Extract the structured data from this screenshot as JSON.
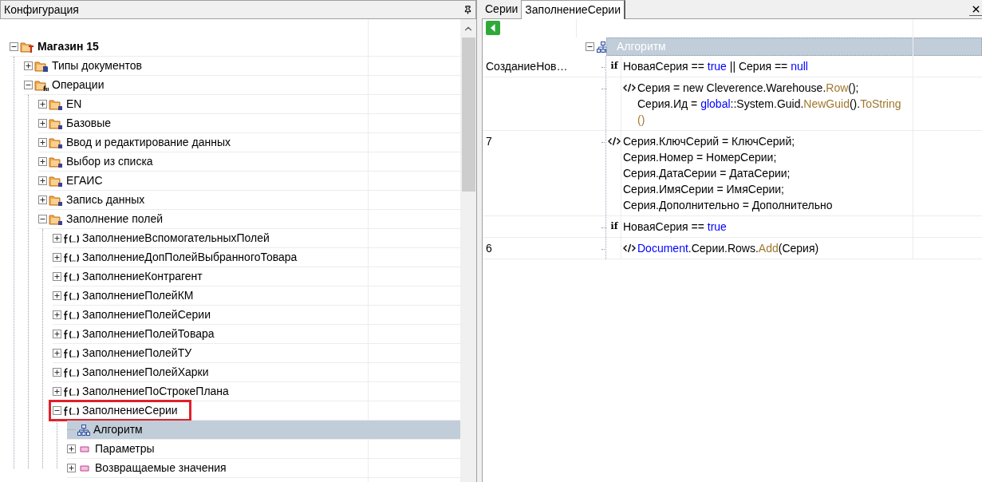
{
  "left_panel": {
    "title": "Конфигурация",
    "tree": [
      {
        "label": "Магазин 15",
        "kind": "root",
        "expanded": true,
        "selected": false,
        "highlighted": false,
        "children": [
          {
            "label": "Типы документов",
            "kind": "doc-folder",
            "expanded": false,
            "selected": false,
            "highlighted": false
          },
          {
            "label": "Операции",
            "kind": "func-folder",
            "expanded": true,
            "selected": false,
            "highlighted": false,
            "children": [
              {
                "label": "EN",
                "kind": "folder",
                "expanded": false,
                "selected": false,
                "highlighted": false
              },
              {
                "label": "Базовые",
                "kind": "folder",
                "expanded": false,
                "selected": false,
                "highlighted": false
              },
              {
                "label": "Ввод и редактирование данных",
                "kind": "folder",
                "expanded": false,
                "selected": false,
                "highlighted": false
              },
              {
                "label": "Выбор из списка",
                "kind": "folder",
                "expanded": false,
                "selected": false,
                "highlighted": false
              },
              {
                "label": "ЕГАИС",
                "kind": "folder",
                "expanded": false,
                "selected": false,
                "highlighted": false
              },
              {
                "label": "Запись данных",
                "kind": "folder",
                "expanded": false,
                "selected": false,
                "highlighted": false
              },
              {
                "label": "Заполнение полей",
                "kind": "folder",
                "expanded": true,
                "selected": false,
                "highlighted": false,
                "children": [
                  {
                    "label": "ЗаполнениеВспомогательныхПолей",
                    "kind": "function",
                    "expanded": false,
                    "selected": false,
                    "highlighted": false
                  },
                  {
                    "label": "ЗаполнениеДопПолейВыбранногоТовара",
                    "kind": "function",
                    "expanded": false,
                    "selected": false,
                    "highlighted": false
                  },
                  {
                    "label": "ЗаполнениеКонтрагент",
                    "kind": "function",
                    "expanded": false,
                    "selected": false,
                    "highlighted": false
                  },
                  {
                    "label": "ЗаполнениеПолейКМ",
                    "kind": "function",
                    "expanded": false,
                    "selected": false,
                    "highlighted": false
                  },
                  {
                    "label": "ЗаполнениеПолейСерии",
                    "kind": "function",
                    "expanded": false,
                    "selected": false,
                    "highlighted": false
                  },
                  {
                    "label": "ЗаполнениеПолейТовара",
                    "kind": "function",
                    "expanded": false,
                    "selected": false,
                    "highlighted": false
                  },
                  {
                    "label": "ЗаполнениеПолейТУ",
                    "kind": "function",
                    "expanded": false,
                    "selected": false,
                    "highlighted": false
                  },
                  {
                    "label": "ЗаполнениеПолейХарки",
                    "kind": "function",
                    "expanded": false,
                    "selected": false,
                    "highlighted": false
                  },
                  {
                    "label": "ЗаполнениеПоСтрокеПлана",
                    "kind": "function",
                    "expanded": false,
                    "selected": false,
                    "highlighted": false
                  },
                  {
                    "label": "ЗаполнениеСерии",
                    "kind": "function",
                    "expanded": true,
                    "selected": false,
                    "highlighted": true,
                    "children": [
                      {
                        "label": "Алгоритм",
                        "kind": "algorithm",
                        "selected": true,
                        "highlighted": false
                      },
                      {
                        "label": "Параметры",
                        "kind": "param",
                        "expanded": false,
                        "selected": false,
                        "highlighted": false
                      },
                      {
                        "label": "Возвращаемые значения",
                        "kind": "param",
                        "expanded": false,
                        "selected": false,
                        "highlighted": false
                      }
                    ]
                  }
                ]
              }
            ]
          }
        ]
      }
    ]
  },
  "right_panel": {
    "tabs": [
      {
        "label": "Серии",
        "selected": false
      },
      {
        "label": "ЗаполнениеСерии",
        "selected": true
      }
    ],
    "algorithm": {
      "label": "Алгоритм",
      "expanded": true,
      "selected": true,
      "children": [
        {
          "kind": "if",
          "badge": "if",
          "column_1": "СозданиеНов…",
          "lines": [
            [
              {
                "text": "НоваяСерия == ",
                "kind": "plain"
              },
              {
                "text": "true",
                "kind": "keyword"
              },
              {
                "text": " || Серия == ",
                "kind": "plain"
              },
              {
                "text": "null",
                "kind": "keyword"
              }
            ]
          ],
          "children": [
            {
              "kind": "code",
              "lines": [
                [
                  {
                    "text": "Серия = new Cleverence.Warehouse.",
                    "kind": "plain"
                  },
                  {
                    "text": "Row",
                    "kind": "member"
                  },
                  {
                    "text": "();",
                    "kind": "plain"
                  }
                ],
                [
                  {
                    "text": "Серия.Ид = ",
                    "kind": "plain"
                  },
                  {
                    "text": "global",
                    "kind": "keyword"
                  },
                  {
                    "text": "::System.Guid.",
                    "kind": "plain"
                  },
                  {
                    "text": "NewGuid",
                    "kind": "member"
                  },
                  {
                    "text": "().",
                    "kind": "plain"
                  },
                  {
                    "text": "ToString",
                    "kind": "member"
                  }
                ],
                [
                  {
                    "text": "()",
                    "kind": "member"
                  }
                ]
              ]
            }
          ]
        },
        {
          "kind": "code",
          "column_1": "7",
          "lines": [
            [
              {
                "text": "Серия.КлючСерий = КлючСерий;",
                "kind": "plain"
              }
            ],
            [
              {
                "text": "Серия.Номер = НомерСерии;",
                "kind": "plain"
              }
            ],
            [
              {
                "text": "Серия.ДатаСерии = ДатаСерии;",
                "kind": "plain"
              }
            ],
            [
              {
                "text": "Серия.ИмяСерии = ИмяСерии;",
                "kind": "plain"
              }
            ],
            [
              {
                "text": "Серия.Дополнительно = Дополнительно",
                "kind": "plain"
              }
            ]
          ]
        },
        {
          "kind": "if",
          "badge": "if",
          "lines": [
            [
              {
                "text": "НоваяСерия == ",
                "kind": "plain"
              },
              {
                "text": "true",
                "kind": "keyword"
              }
            ]
          ],
          "children": [
            {
              "kind": "code",
              "column_1": "6",
              "lines": [
                [
                  {
                    "text": "Document",
                    "kind": "keyword"
                  },
                  {
                    "text": ".Серии.Rows.",
                    "kind": "plain"
                  },
                  {
                    "text": "Add",
                    "kind": "member"
                  },
                  {
                    "text": "(Серия)",
                    "kind": "plain"
                  }
                ]
              ]
            }
          ]
        }
      ]
    }
  }
}
